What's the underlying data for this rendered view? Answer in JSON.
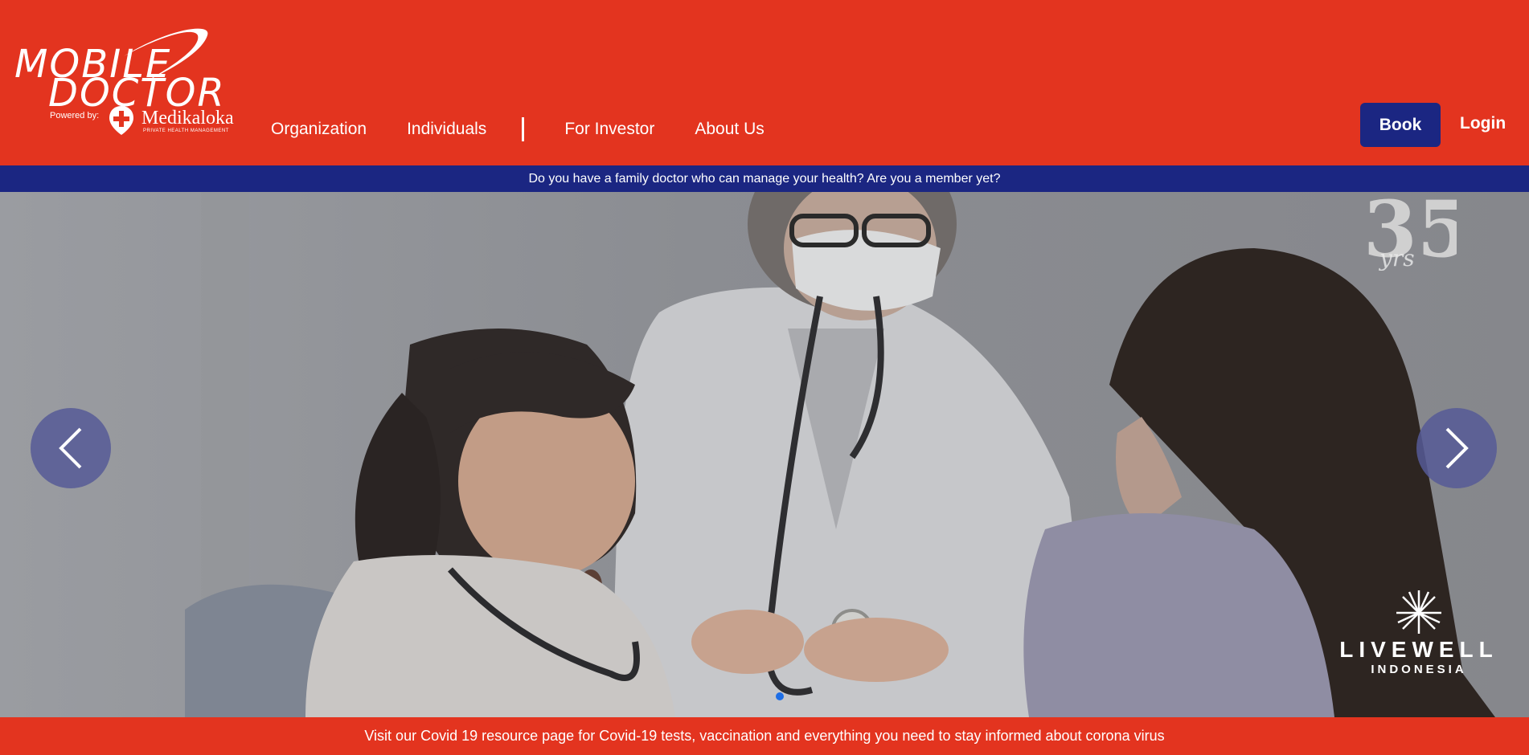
{
  "logo": {
    "line1": "MOBILE",
    "line2": "DOCTOR",
    "powered_by": "Powered by:",
    "partner_name": "Medikaloka",
    "partner_tagline": "PRIVATE HEALTH MANAGEMENT"
  },
  "nav": {
    "items": [
      {
        "label": "Organization"
      },
      {
        "label": "Individuals"
      },
      {
        "label": "For Investor"
      },
      {
        "label": "About Us"
      }
    ]
  },
  "actions": {
    "book_label": "Book",
    "login_label": "Login"
  },
  "announcement": "Do you have a family doctor who can manage your health? Are you a member yet?",
  "hero": {
    "badge_icon": "35-years-anniversary-icon",
    "sponsor_title": "LIVEWELL",
    "sponsor_subtitle": "INDONESIA",
    "active_slide": 1
  },
  "footer_notice": "Visit our Covid 19 resource page for Covid-19 tests, vaccination and everything you need to stay informed about corona virus",
  "colors": {
    "brand_red": "#e3341f",
    "brand_navy": "#1b2682",
    "arrow_bg": "#565a96",
    "active_dot": "#1e6ee6"
  }
}
